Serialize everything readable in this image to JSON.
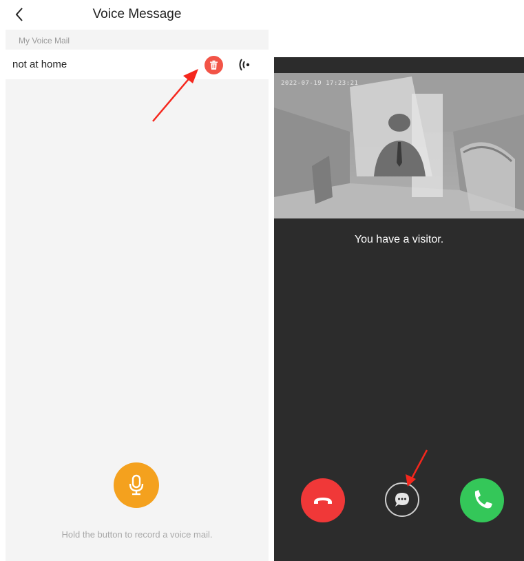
{
  "voice_message_screen": {
    "title": "Voice Message",
    "back_icon": "chevron-left-icon",
    "section_label": "My Voice Mail",
    "messages": [
      {
        "title": "not at home",
        "delete_icon": "trash-icon",
        "play_icon": "speaker-wave-icon"
      }
    ],
    "record_icon": "microphone-icon",
    "record_hint": "Hold the button to record a voice mail.",
    "colors": {
      "delete": "#f25447",
      "record": "#f4a11e",
      "background": "#f4f4f4"
    }
  },
  "incoming_call_screen": {
    "timestamp": "2022-07-19 17:23:21",
    "message": "You have a visitor.",
    "buttons": {
      "reject_icon": "hang-up-icon",
      "chat_icon": "chat-bubble-icon",
      "accept_icon": "phone-icon"
    },
    "colors": {
      "reject": "#f03838",
      "accept": "#34c759",
      "background": "#2c2c2c"
    }
  },
  "annotations": {
    "arrow_color": "#f5271d"
  }
}
